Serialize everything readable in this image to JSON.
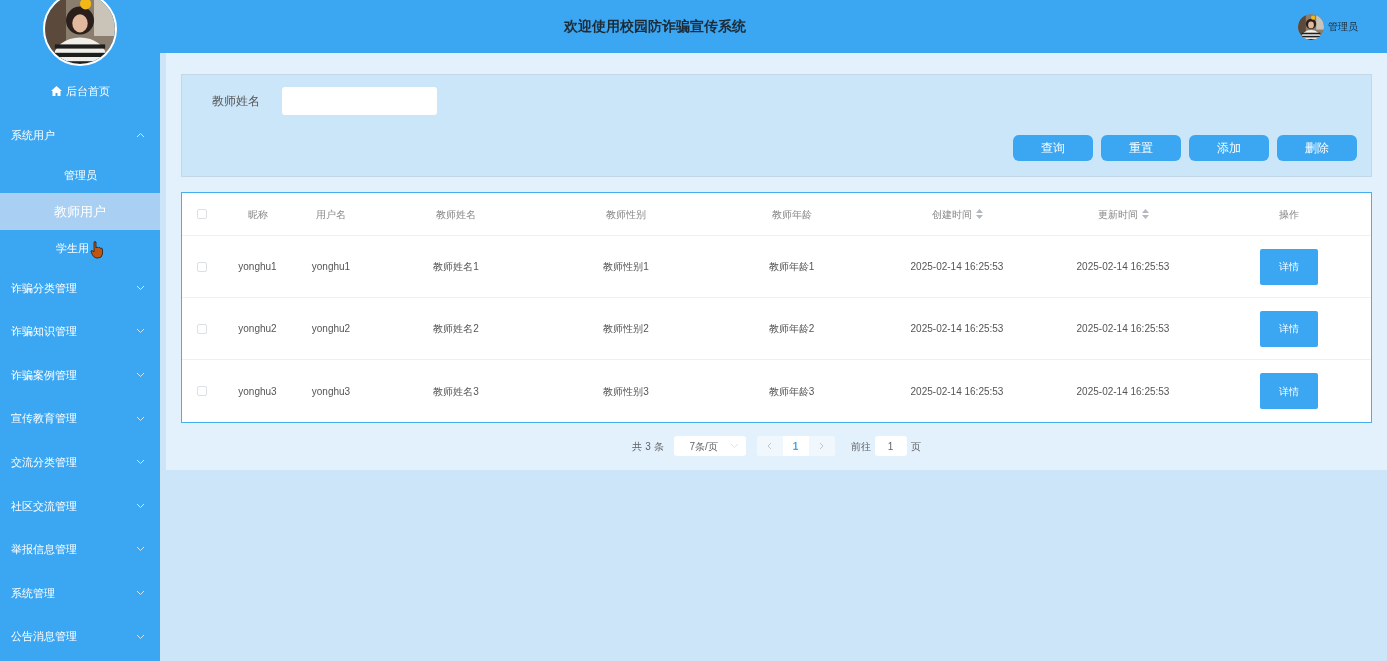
{
  "header": {
    "title": "欢迎使用校园防诈骗宣传系统",
    "user": {
      "name": "管理员"
    }
  },
  "sidebar": {
    "home": "后台首页",
    "menus": [
      {
        "label": "系统用户",
        "expanded": true,
        "children": [
          {
            "label": "管理员",
            "selected": false
          },
          {
            "label": "教师用户",
            "selected": true
          },
          {
            "label": "学生用",
            "selected": false,
            "cursor": true
          }
        ]
      },
      {
        "label": "诈骗分类管理",
        "expanded": false
      },
      {
        "label": "诈骗知识管理",
        "expanded": false
      },
      {
        "label": "诈骗案例管理",
        "expanded": false
      },
      {
        "label": "宣传教育管理",
        "expanded": false
      },
      {
        "label": "交流分类管理",
        "expanded": false
      },
      {
        "label": "社区交流管理",
        "expanded": false
      },
      {
        "label": "举报信息管理",
        "expanded": false
      },
      {
        "label": "系统管理",
        "expanded": false
      },
      {
        "label": "公告消息管理",
        "expanded": false
      }
    ]
  },
  "search": {
    "label": "教师姓名",
    "buttons": [
      "查询",
      "重置",
      "添加",
      "删除"
    ]
  },
  "table": {
    "all_checked": false,
    "columns": [
      {
        "label": "昵称",
        "kind": "plain"
      },
      {
        "label": "用户名",
        "kind": "plain"
      },
      {
        "label": "教师姓名",
        "kind": "plain"
      },
      {
        "label": "教师性别",
        "kind": "plain"
      },
      {
        "label": "教师年龄",
        "kind": "plain"
      },
      {
        "label": "创建时间",
        "kind": "sortable"
      },
      {
        "label": "更新时间",
        "kind": "sortable"
      },
      {
        "label": "操作",
        "kind": "plain"
      }
    ],
    "rows": [
      {
        "checked": false,
        "cells": [
          "yonghu1",
          "yonghu1",
          "教师姓名1",
          "教师性别1",
          "教师年龄1",
          "2025-02-14 16:25:53",
          "2025-02-14 16:25:53"
        ],
        "action": "详情"
      },
      {
        "checked": false,
        "cells": [
          "yonghu2",
          "yonghu2",
          "教师姓名2",
          "教师性别2",
          "教师年龄2",
          "2025-02-14 16:25:53",
          "2025-02-14 16:25:53"
        ],
        "action": "详情"
      },
      {
        "checked": false,
        "cells": [
          "yonghu3",
          "yonghu3",
          "教师姓名3",
          "教师性别3",
          "教师年龄3",
          "2025-02-14 16:25:53",
          "2025-02-14 16:25:53"
        ],
        "action": "详情"
      }
    ]
  },
  "pagination": {
    "total": "共 3 条",
    "page_size": "7条/页",
    "pages": [
      {
        "label": "1",
        "selected": true
      }
    ],
    "goto_label": "前往",
    "goto_value": "1",
    "page_suffix": "页"
  }
}
